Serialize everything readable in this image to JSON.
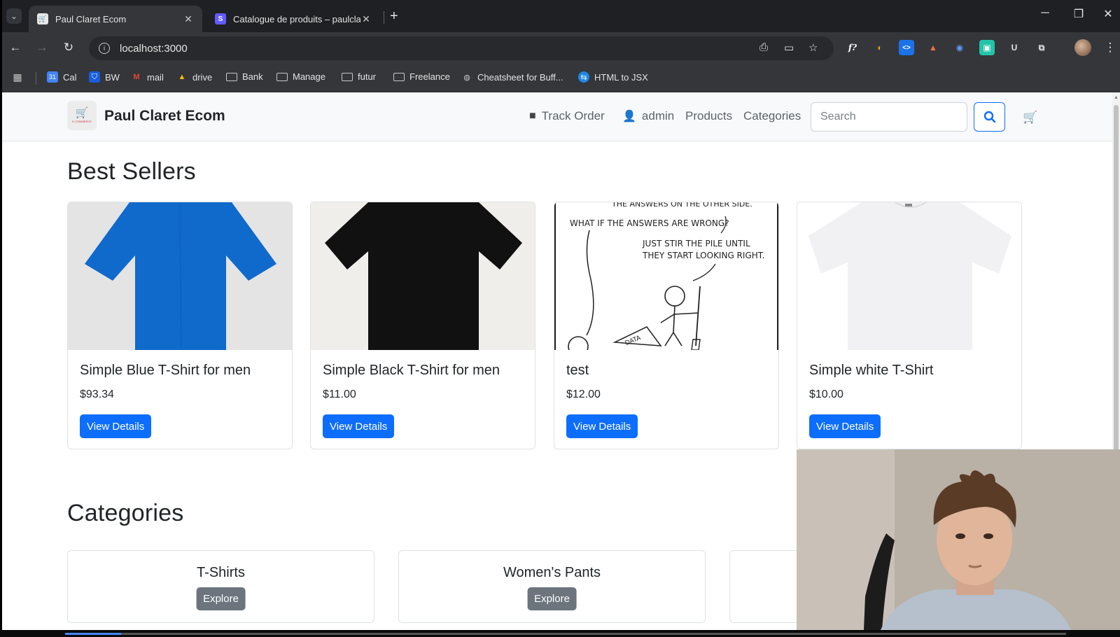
{
  "browser": {
    "tabs": [
      {
        "title": "Paul Claret Ecom",
        "active": true
      },
      {
        "title": "Catalogue de produits – paulcla",
        "active": false
      }
    ],
    "url": "localhost:3000",
    "bookmarks": [
      "Cal",
      "BW",
      "mail",
      "drive",
      "Bank",
      "Manage",
      "futur",
      "Freelance",
      "Cheatsheet for Buff...",
      "HTML to JSX"
    ]
  },
  "navbar": {
    "brand": "Paul Claret Ecom",
    "logo_text": "E-COMMERCE",
    "links": {
      "track_order": "Track Order",
      "admin": "admin",
      "products": "Products",
      "categories": "Categories"
    },
    "search_placeholder": "Search"
  },
  "best_sellers": {
    "heading": "Best Sellers",
    "products": [
      {
        "name": "Simple Blue T-Shirt for men",
        "price": "$93.34",
        "button": "View Details",
        "image": "blue-tshirt"
      },
      {
        "name": "Simple Black T-Shirt for men",
        "price": "$11.00",
        "button": "View Details",
        "image": "black-tshirt"
      },
      {
        "name": "test",
        "price": "$12.00",
        "button": "View Details",
        "image": "comic-strip"
      },
      {
        "name": "Simple white T-Shirt",
        "price": "$10.00",
        "button": "View Details",
        "image": "white-tshirt"
      }
    ],
    "comic_text": [
      "THE ANSWERS ON THE OTHER SIDE.",
      "WHAT IF THE ANSWERS ARE WRONG?",
      "JUST STIR THE PILE UNTIL",
      "THEY START LOOKING RIGHT.",
      "DATA"
    ]
  },
  "categories": {
    "heading": "Categories",
    "items": [
      {
        "name": "T-Shirts",
        "button": "Explore"
      },
      {
        "name": "Women's Pants",
        "button": "Explore"
      }
    ]
  },
  "colors": {
    "primary": "#0d6efd",
    "secondary": "#6c757d",
    "navbar_bg": "#f8f9fa",
    "chrome_dark": "#35363a"
  }
}
